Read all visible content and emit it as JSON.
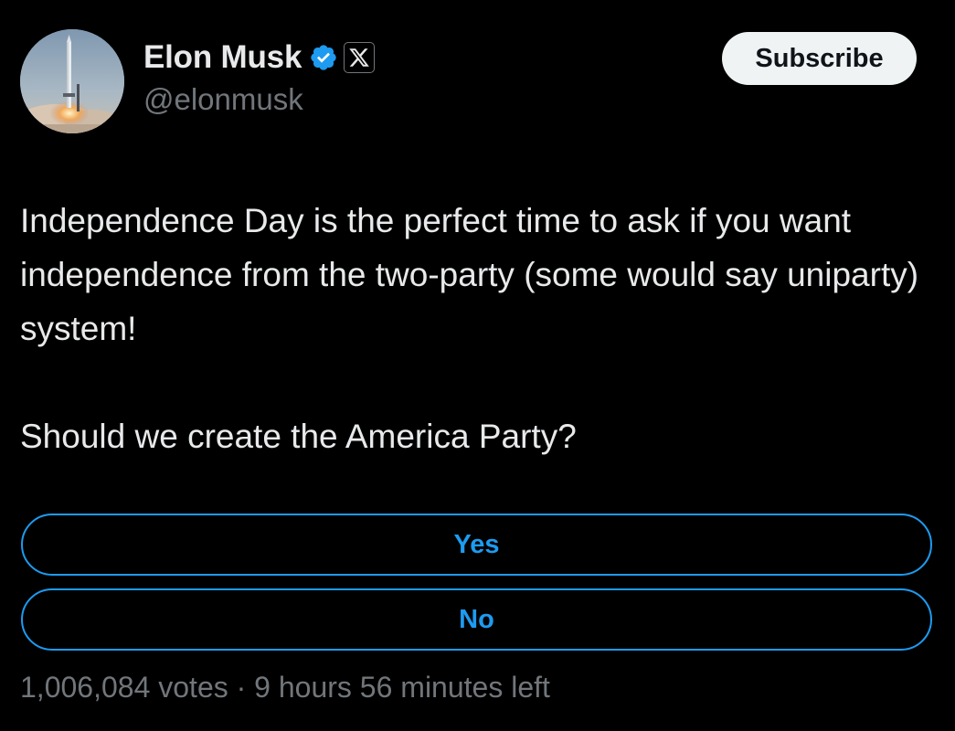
{
  "author": {
    "display_name": "Elon Musk",
    "handle": "@elonmusk",
    "verified_icon": "verified-badge-icon",
    "affiliation_icon": "x-logo-icon"
  },
  "header": {
    "subscribe_label": "Subscribe"
  },
  "tweet": {
    "text": "Independence Day is the perfect time to ask if you want independence from the two-party (some would say uniparty) system!\n\nShould we create the America Party?"
  },
  "poll": {
    "options": [
      {
        "label": "Yes"
      },
      {
        "label": "No"
      }
    ],
    "votes": "1,006,084 votes",
    "separator": "·",
    "time_left": "9 hours 56 minutes left"
  },
  "colors": {
    "background": "#000000",
    "text": "#e7e9ea",
    "muted": "#71767b",
    "accent": "#1d9bf0",
    "button_bg": "#eff3f4"
  }
}
